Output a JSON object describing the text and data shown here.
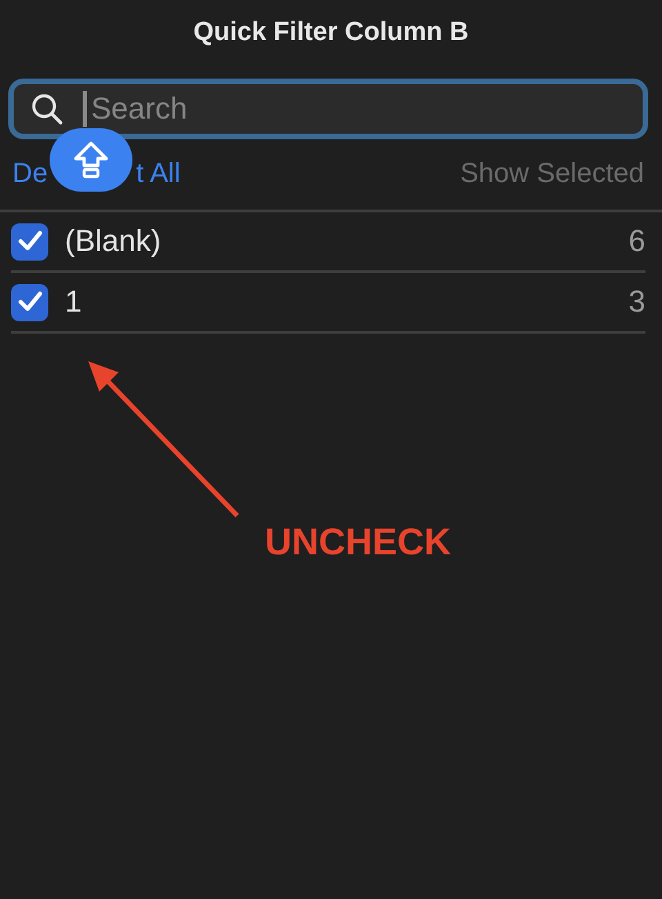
{
  "window": {
    "title": "Quick Filter Column B"
  },
  "search": {
    "placeholder": "Search"
  },
  "actions": {
    "deselect_all_visible_parts": [
      "De",
      "t All"
    ],
    "show_selected": {
      "label": "Show Selected",
      "disabled": true
    }
  },
  "items": [
    {
      "label": "(Blank)",
      "count": "6",
      "checked": true
    },
    {
      "label": "1",
      "count": "3",
      "checked": true
    }
  ],
  "annotation": {
    "label": "UNCHECK"
  }
}
